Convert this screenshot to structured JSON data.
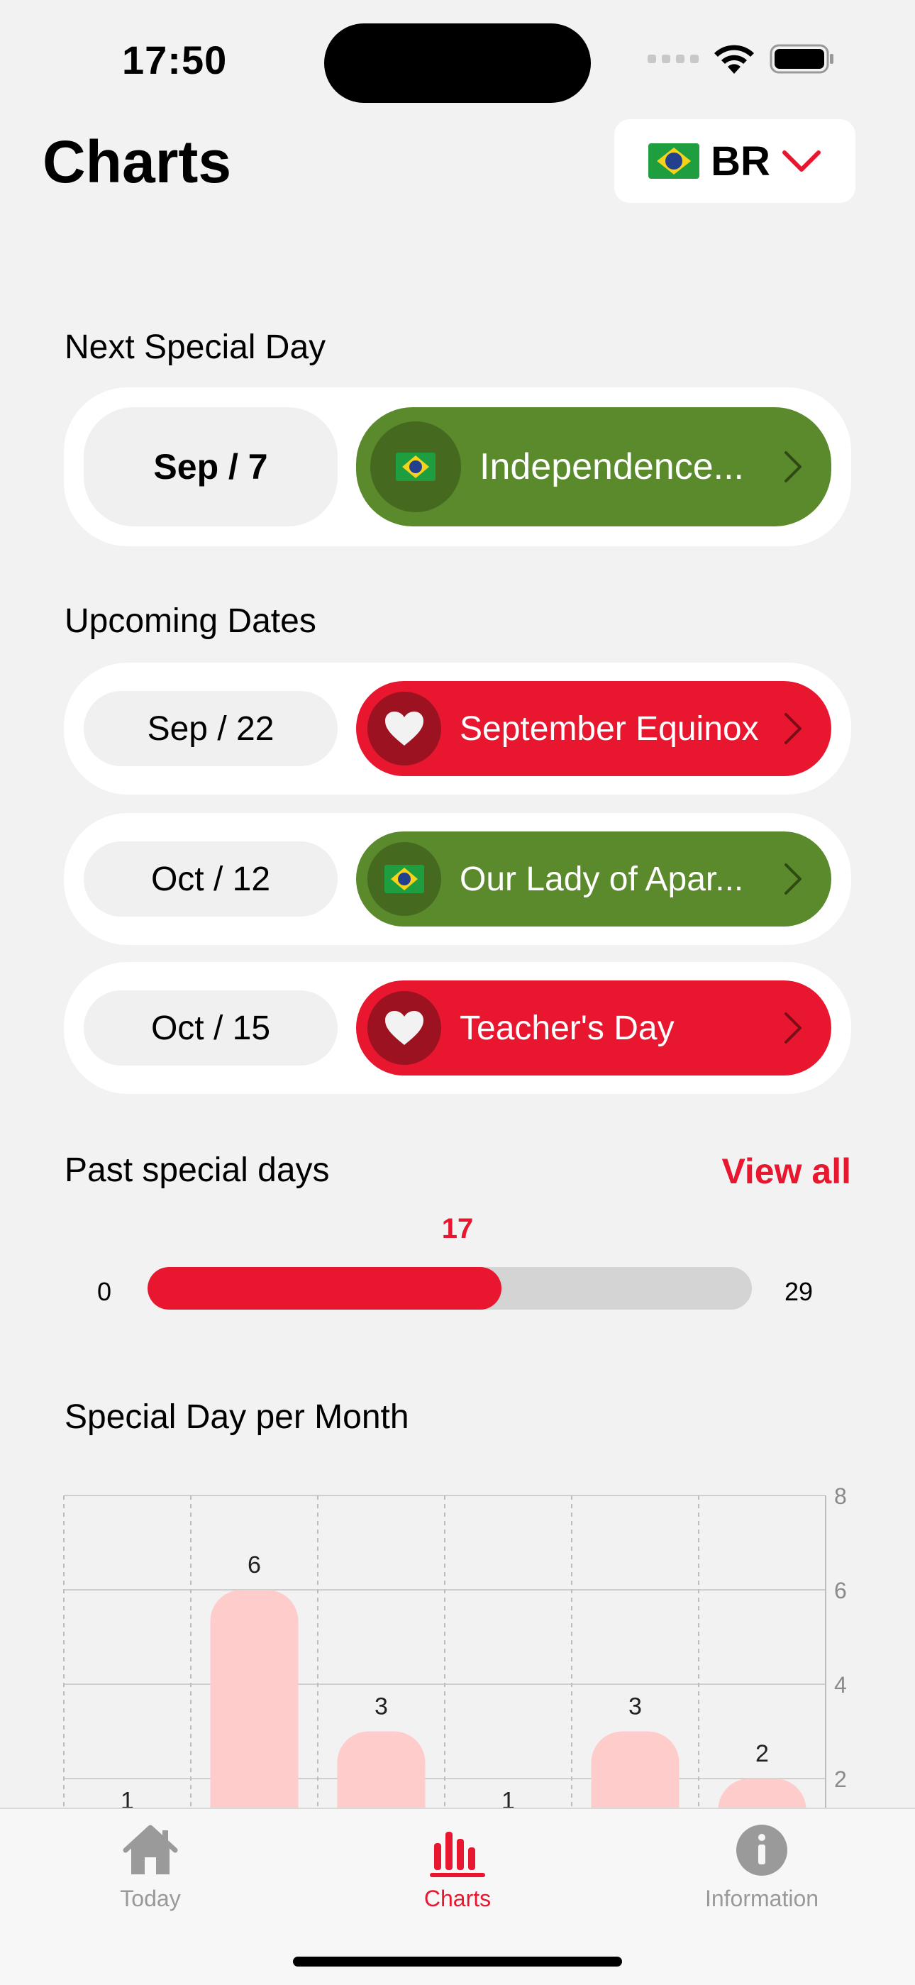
{
  "status_bar": {
    "time": "17:50"
  },
  "header": {
    "title": "Charts",
    "country_code": "BR",
    "country_flag_icon": "brazil-flag-icon"
  },
  "next_special_day": {
    "section_label": "Next Special Day",
    "date": "Sep / 7",
    "event": "Independence...",
    "icon": "brazil-flag-icon",
    "color": "#5a8a2b"
  },
  "upcoming": {
    "section_label": "Upcoming Dates",
    "items": [
      {
        "date": "Sep / 22",
        "event": "September Equinox",
        "icon": "heart-icon",
        "color": "#e8172f"
      },
      {
        "date": "Oct / 12",
        "event": "Our Lady of Apar...",
        "icon": "brazil-flag-icon",
        "color": "#5a8a2b"
      },
      {
        "date": "Oct / 15",
        "event": "Teacher's Day",
        "icon": "heart-icon",
        "color": "#e8172f"
      }
    ]
  },
  "past": {
    "section_label": "Past special days",
    "view_all": "View all",
    "value": 17,
    "min": 0,
    "max": 29
  },
  "per_month": {
    "section_label": "Special Day per Month"
  },
  "chart_data": {
    "type": "bar",
    "values": [
      1,
      6,
      3,
      1,
      3,
      2
    ],
    "data_labels": [
      "1",
      "6",
      "3",
      "1",
      "3",
      "2"
    ],
    "y_ticks": [
      "8",
      "6",
      "4",
      "2"
    ],
    "ylim": [
      0,
      8
    ],
    "bar_color": "#ffcccc",
    "grid": true,
    "y_axis_position": "right"
  },
  "tabbar": {
    "tabs": [
      {
        "label": "Today",
        "icon": "house-icon",
        "active": false
      },
      {
        "label": "Charts",
        "icon": "bar-chart-icon",
        "active": true
      },
      {
        "label": "Information",
        "icon": "info-icon",
        "active": false
      }
    ]
  },
  "colors": {
    "accent": "#e8172f",
    "green": "#5a8a2b",
    "background": "#f2f2f2"
  }
}
